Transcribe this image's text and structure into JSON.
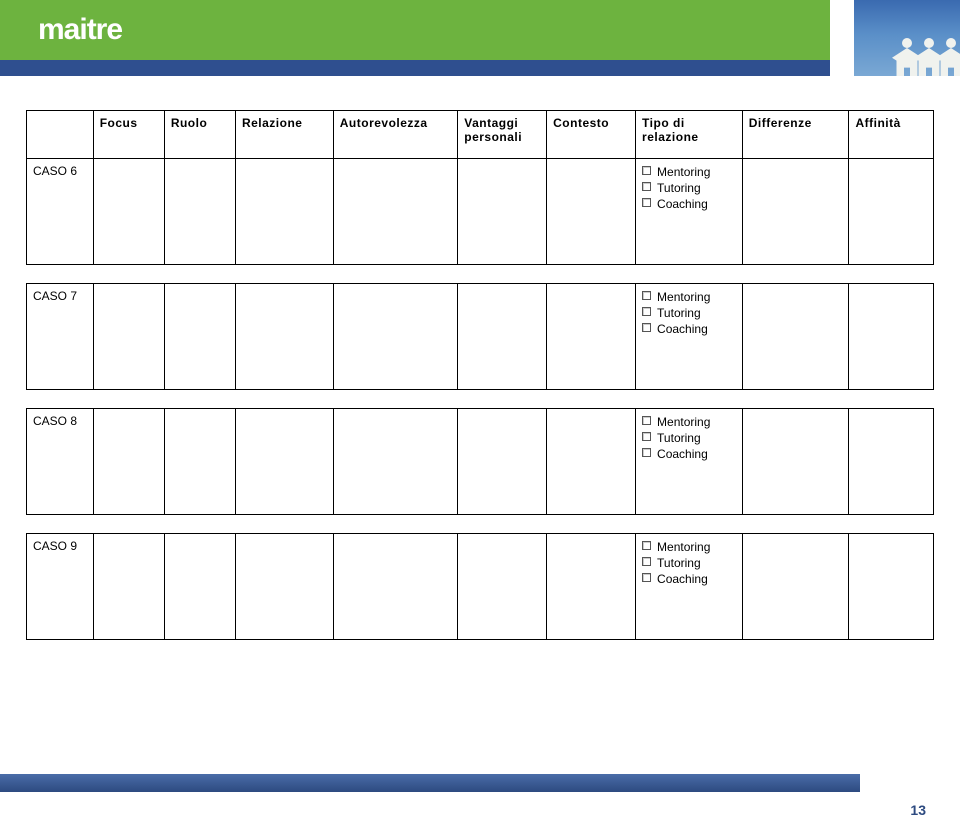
{
  "brand": "maitre",
  "columns": {
    "empty": "",
    "focus": "Focus",
    "ruolo": "Ruolo",
    "relazione": "Relazione",
    "autorevolezza": "Autorevolezza",
    "vantaggi": "Vantaggi personali",
    "contesto": "Contesto",
    "tipo": "Tipo di relazione",
    "differenze": "Differenze",
    "affinita": "Affinità"
  },
  "options": {
    "mentoring": "Mentoring",
    "tutoring": "Tutoring",
    "coaching": "Coaching"
  },
  "rows": {
    "c6": "CASO 6",
    "c7": "CASO 7",
    "c8": "CASO 8",
    "c9": "CASO 9"
  },
  "pageNumber": "13"
}
